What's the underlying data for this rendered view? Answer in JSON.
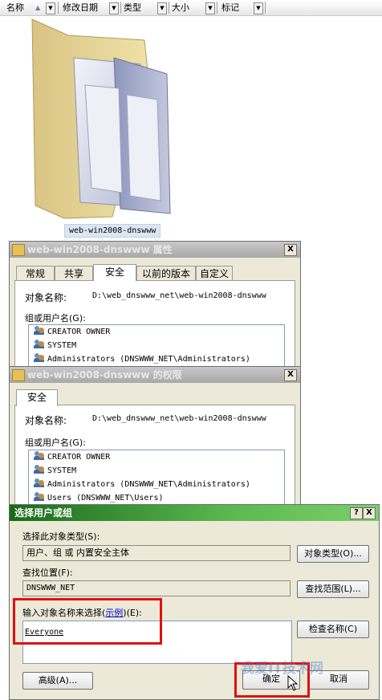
{
  "columns": [
    {
      "label": "名称"
    },
    {
      "label": "修改日期"
    },
    {
      "label": "类型"
    },
    {
      "label": "大小"
    },
    {
      "label": "标记"
    }
  ],
  "sort_indicator": "▲",
  "folder": {
    "name": "web-win2008-dnswww"
  },
  "properties_window": {
    "title": "web-win2008-dnswww 属性",
    "close_label": "X",
    "tabs": [
      "常规",
      "共享",
      "安全",
      "以前的版本",
      "自定义"
    ],
    "active_tab": "安全",
    "object_name_label": "对象名称:",
    "object_name_value": "D:\\web_dnswww_net\\web-win2008-dnswww",
    "group_label": "组或用户名(G):",
    "users": [
      "CREATOR OWNER",
      "SYSTEM",
      "Administrators (DNSWWW_NET\\Administrators)"
    ]
  },
  "permissions_window": {
    "title": "web-win2008-dnswww 的权限",
    "close_label": "X",
    "tab": "安全",
    "object_name_label": "对象名称:",
    "object_name_value": "D:\\web_dnswww_net\\web-win2008-dnswww",
    "group_label": "组或用户名(G):",
    "users": [
      "CREATOR OWNER",
      "SYSTEM",
      "Administrators (DNSWWW_NET\\Administrators)",
      "Users (DNSWWW_NET\\Users)"
    ]
  },
  "select_dialog": {
    "title": "选择用户或组",
    "help_label": "?",
    "close_label": "X",
    "object_type_label": "选择此对象类型(S):",
    "object_type_value": "用户、组 或 内置安全主体",
    "object_type_button": "对象类型(O)...",
    "location_label": "查找位置(F):",
    "location_value": "DNSWWW_NET",
    "location_button": "查找范围(L)...",
    "enter_label_pre": "输入对象名称来选择(",
    "enter_label_link": "示例",
    "enter_label_post": ")(E):",
    "object_name_input": "Everyone",
    "check_names_button": "检查名称(C)",
    "advanced_button": "高级(A)...",
    "ok_button": "确定",
    "cancel_button": "取消"
  },
  "watermark": "我爱IT技术网",
  "colors": {
    "highlight": "#e01010",
    "title_green": "#3e9a3e"
  }
}
